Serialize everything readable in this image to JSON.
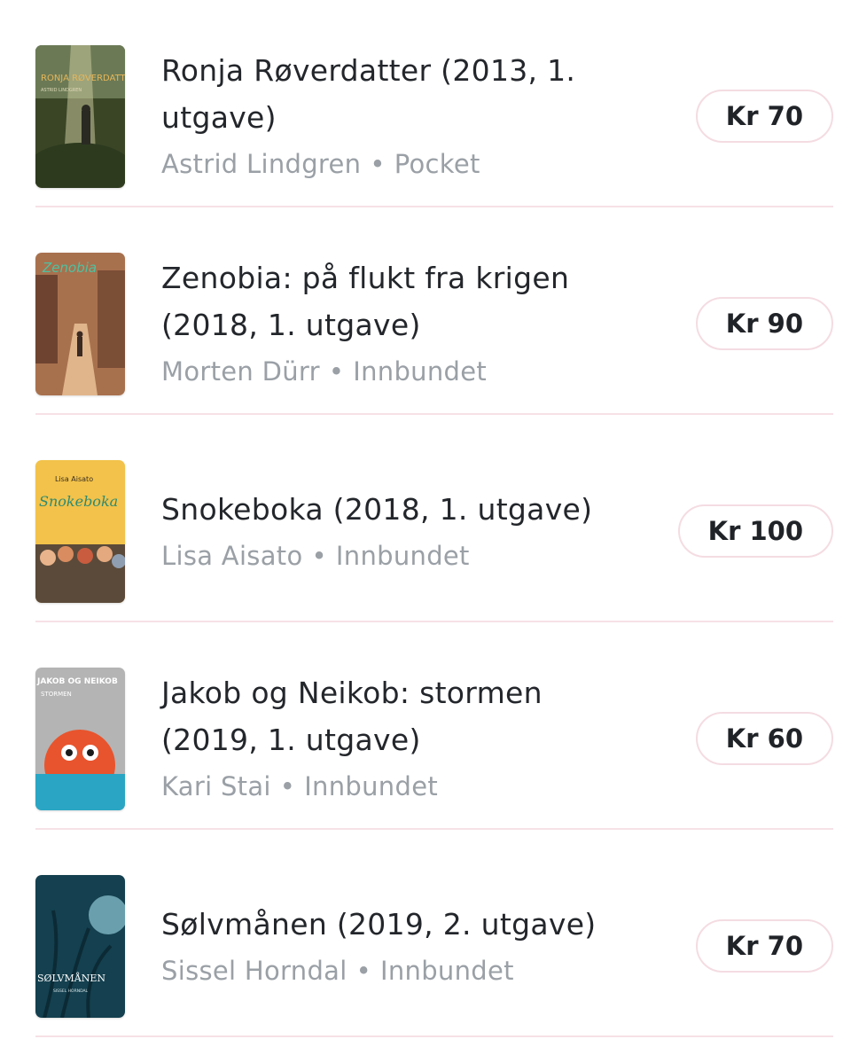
{
  "books": [
    {
      "title": "Ronja Røverdatter (2013, 1. utgave)",
      "title_lines": [
        "Ronja Røverdatter (2013, 1.",
        "utgave)"
      ],
      "author": "Astrid Lindgren",
      "format": "Pocket",
      "separator": "•",
      "price": "Kr 70",
      "cover": {
        "title": "RONJA RØVERDATTER",
        "author": "ASTRID LINDGREN",
        "palette": "#3f4a2a"
      }
    },
    {
      "title": "Zenobia: på flukt fra krigen (2018, 1. utgave)",
      "title_lines": [
        "Zenobia: på flukt fra krigen",
        "(2018, 1. utgave)"
      ],
      "author": "Morten Dürr",
      "format": "Innbundet",
      "separator": "•",
      "price": "Kr 90",
      "cover": {
        "title": "Zenobia",
        "subtitle": "på flukt fra krigen",
        "palette": "#8c5a3c"
      }
    },
    {
      "title": "Snokeboka (2018, 1. utgave)",
      "title_lines": [
        "Snokeboka (2018, 1. utgave)"
      ],
      "author": "Lisa Aisato",
      "format": "Innbundet",
      "separator": "•",
      "price": "Kr 100",
      "cover": {
        "title": "Snokeboka",
        "author": "Lisa Aisato",
        "palette": "#f2c24a"
      }
    },
    {
      "title": "Jakob og Neikob: stormen (2019, 1. utgave)",
      "title_lines": [
        "Jakob og Neikob: stormen",
        "(2019, 1. utgave)"
      ],
      "author": "Kari Stai",
      "format": "Innbundet",
      "separator": "•",
      "price": "Kr 60",
      "cover": {
        "title": "JAKOB OG NEIKOB",
        "subtitle": "STORMEN",
        "palette": "#e8542d"
      }
    },
    {
      "title": "Sølvmånen (2019, 2. utgave)",
      "title_lines": [
        "Sølvmånen (2019, 2. utgave)"
      ],
      "author": "Sissel Horndal",
      "format": "Innbundet",
      "separator": "•",
      "price": "Kr 70",
      "cover": {
        "title": "SØLVMÅNEN",
        "author": "SISSEL HORNDAL",
        "palette": "#1b5a6e"
      }
    }
  ],
  "colors": {
    "divider": "#f6e1e6",
    "price_border": "#f4dce2",
    "title": "#23262b",
    "meta": "#9aa0a6"
  }
}
